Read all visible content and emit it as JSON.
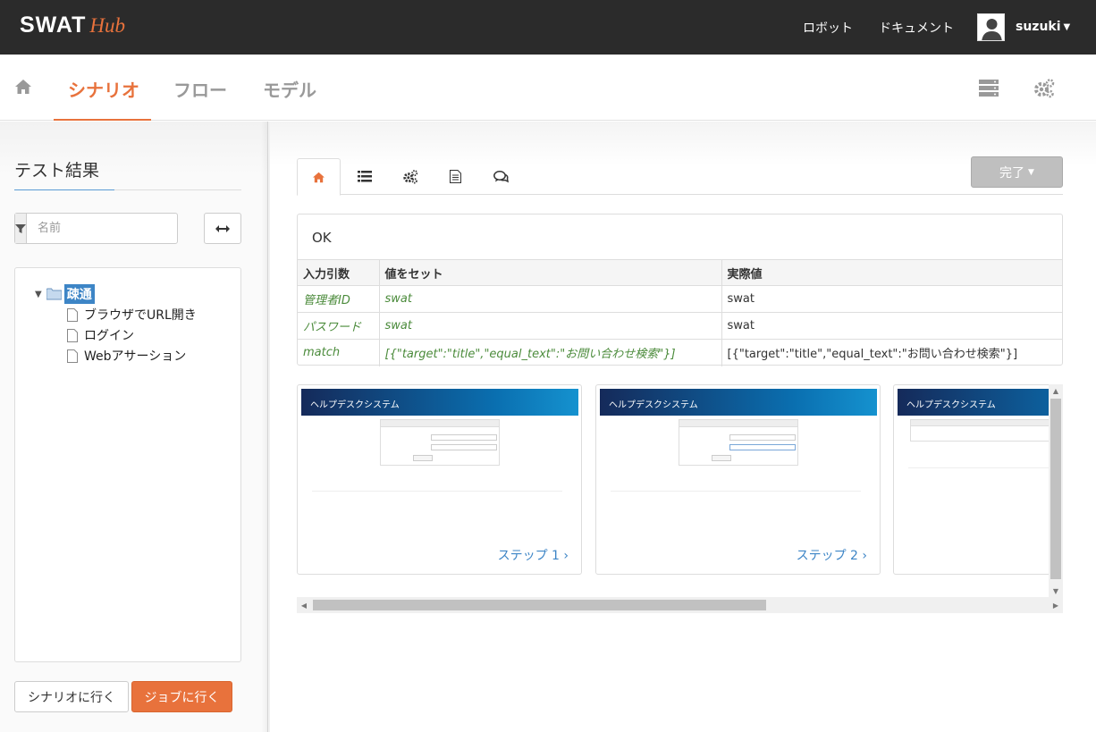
{
  "app": {
    "logo_main": "SWAT",
    "logo_sub": "Hub",
    "accent_color": "#e8723c"
  },
  "topnav": {
    "robot": "ロボット",
    "docs": "ドキュメント",
    "username": "suzuki"
  },
  "subnav": {
    "scenario": "シナリオ",
    "flow": "フロー",
    "model": "モデル"
  },
  "left": {
    "title": "テスト結果",
    "filter_placeholder": "名前",
    "tree": {
      "root": "疎通",
      "children": [
        "ブラウザでURL開き",
        "ログイン",
        "Webアサーション"
      ]
    },
    "go_scenario": "シナリオに行く",
    "go_job": "ジョブに行く"
  },
  "main": {
    "done_label": "完了",
    "status": "OK",
    "table": {
      "headers": [
        "入力引数",
        "値をセット",
        "実際値"
      ],
      "rows": [
        [
          "管理者ID",
          "swat",
          "swat"
        ],
        [
          "パスワード",
          "swat",
          "swat"
        ],
        [
          "match",
          "[{\"target\":\"title\",\"equal_text\":\"お問い合わせ検索\"}]",
          "[{\"target\":\"title\",\"equal_text\":\"お問い合わせ検索\"}]"
        ]
      ]
    },
    "screenshots": [
      {
        "header": "ヘルプデスクシステム",
        "step": "ステップ 1"
      },
      {
        "header": "ヘルプデスクシステム",
        "step": "ステップ 2"
      },
      {
        "header": "ヘルプデスクシステム",
        "step": ""
      }
    ]
  }
}
